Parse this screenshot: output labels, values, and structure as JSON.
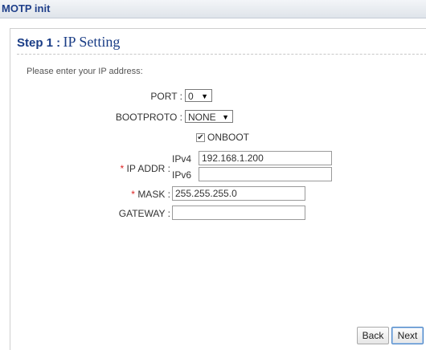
{
  "window": {
    "title": "MOTP init"
  },
  "step": {
    "number": "Step 1 :",
    "name": "IP Setting"
  },
  "instruction": "Please enter your IP address:",
  "form": {
    "port": {
      "label": "PORT :",
      "value": "0"
    },
    "bootproto": {
      "label": "BOOTPROTO :",
      "value": "NONE"
    },
    "onboot": {
      "label": "ONBOOT",
      "checked": true,
      "check_mark": "✔"
    },
    "ip_addr": {
      "required_mark": "*",
      "label": "IP ADDR :",
      "ipv4_label": "IPv4",
      "ipv4_value": "192.168.1.200",
      "ipv6_label": "IPv6",
      "ipv6_value": ""
    },
    "mask": {
      "required_mark": "*",
      "label": "MASK :",
      "value": "255.255.255.0"
    },
    "gateway": {
      "label": "GATEWAY :",
      "value": ""
    }
  },
  "buttons": {
    "back": "Back",
    "next": "Next"
  },
  "colors": {
    "title": "#1f3f8a",
    "heading": "#1a3d86",
    "required": "#dd2222",
    "next_border": "#4a84c6"
  },
  "icons": {
    "select_arrow": "chevron-down-icon",
    "checkbox": "checkmark-icon"
  }
}
